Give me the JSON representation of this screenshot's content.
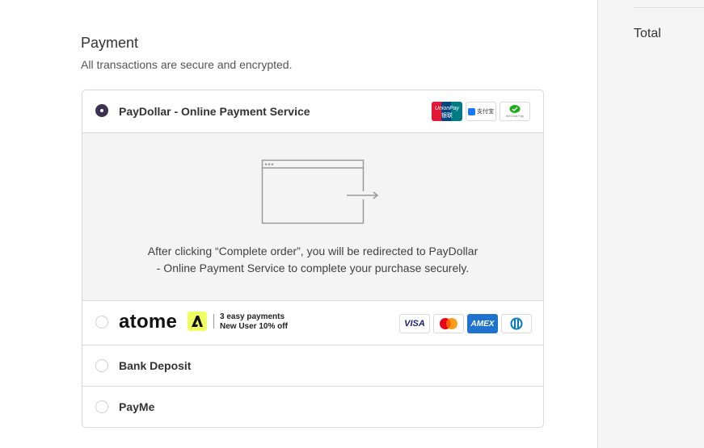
{
  "payment": {
    "title": "Payment",
    "subtitle": "All transactions are secure and encrypted.",
    "options": [
      {
        "label": "PayDollar - Online Payment Service",
        "selected": true,
        "logos": [
          "unionpay-logo",
          "alipay-logo",
          "wechat-pay-logo"
        ]
      },
      {
        "label": "atome",
        "selected": false,
        "promo_line1": "3 easy payments",
        "promo_line2": "New User 10% off",
        "logos": [
          "visa-logo",
          "mastercard-logo",
          "amex-logo",
          "diners-logo"
        ]
      },
      {
        "label": "Bank Deposit",
        "selected": false
      },
      {
        "label": "PayMe",
        "selected": false
      }
    ],
    "redirect_text_line1": "After clicking “Complete order”, you will be redirected to PayDollar",
    "redirect_text_line2": "- Online Payment Service to complete your purchase securely."
  },
  "logo_text": {
    "unionpay_top": "UnionPay",
    "unionpay_bottom": "银联",
    "alipay": "支付宝",
    "wechat": "WeChat Pay",
    "visa": "VISA",
    "amex": "AMEX"
  },
  "summary": {
    "total_label": "Total"
  },
  "colors": {
    "accent": "#3d3050",
    "atome_yellow": "#f0ff5f",
    "amex_blue": "#1f72cd",
    "visa_blue": "#1a1f71"
  }
}
